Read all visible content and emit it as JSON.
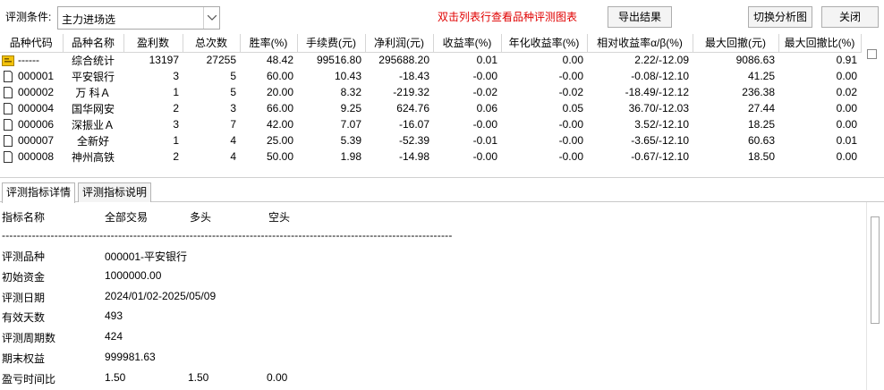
{
  "toolbar": {
    "condition_label": "评测条件:",
    "condition_value": "主力进场选",
    "hint": "双击列表行查看品种评测图表",
    "export_label": "导出结果",
    "switch_label": "切换分析图",
    "close_label": "关闭"
  },
  "table": {
    "columns": [
      "品种代码",
      "品种名称",
      "盈利数",
      "总次数",
      "胜率(%)",
      "手续费(元)",
      "净利润(元)",
      "收益率(%)",
      "年化收益率(%)",
      "相对收益率α/β(%)",
      "最大回撤(元)",
      "最大回撤比(%)"
    ],
    "rows": [
      {
        "code": "------",
        "name": "综合统计",
        "win": "13197",
        "total": "27255",
        "rate": "48.42",
        "fee": "99516.80",
        "profit": "295688.20",
        "ret": "0.01",
        "annual": "0.00",
        "rel": "2.22/-12.09",
        "mdd": "9086.63",
        "mddr": "0.91",
        "icon": "summary-icon"
      },
      {
        "code": "000001",
        "name": "平安银行",
        "win": "3",
        "total": "5",
        "rate": "60.00",
        "fee": "10.43",
        "profit": "-18.43",
        "ret": "-0.00",
        "annual": "-0.00",
        "rel": "-0.08/-12.10",
        "mdd": "41.25",
        "mddr": "0.00",
        "icon": "document-icon"
      },
      {
        "code": "000002",
        "name": "万 科Ａ",
        "win": "1",
        "total": "5",
        "rate": "20.00",
        "fee": "8.32",
        "profit": "-219.32",
        "ret": "-0.02",
        "annual": "-0.02",
        "rel": "-18.49/-12.12",
        "mdd": "236.38",
        "mddr": "0.02",
        "icon": "document-icon"
      },
      {
        "code": "000004",
        "name": "国华网安",
        "win": "2",
        "total": "3",
        "rate": "66.00",
        "fee": "9.25",
        "profit": "624.76",
        "ret": "0.06",
        "annual": "0.05",
        "rel": "36.70/-12.03",
        "mdd": "27.44",
        "mddr": "0.00",
        "icon": "document-icon"
      },
      {
        "code": "000006",
        "name": "深振业Ａ",
        "win": "3",
        "total": "7",
        "rate": "42.00",
        "fee": "7.07",
        "profit": "-16.07",
        "ret": "-0.00",
        "annual": "-0.00",
        "rel": "3.52/-12.10",
        "mdd": "18.25",
        "mddr": "0.00",
        "icon": "document-icon"
      },
      {
        "code": "000007",
        "name": "全新好",
        "win": "1",
        "total": "4",
        "rate": "25.00",
        "fee": "5.39",
        "profit": "-52.39",
        "ret": "-0.01",
        "annual": "-0.00",
        "rel": "-3.65/-12.10",
        "mdd": "60.63",
        "mddr": "0.01",
        "icon": "document-icon"
      },
      {
        "code": "000008",
        "name": "神州高铁",
        "win": "2",
        "total": "4",
        "rate": "50.00",
        "fee": "1.98",
        "profit": "-14.98",
        "ret": "-0.00",
        "annual": "-0.00",
        "rel": "-0.67/-12.10",
        "mdd": "18.50",
        "mddr": "0.00",
        "icon": "document-icon"
      }
    ]
  },
  "tabs": [
    "评测指标详情",
    "评测指标说明"
  ],
  "detail": {
    "header": {
      "name": "指标名称",
      "all": "全部交易",
      "long": "多头",
      "short": "空头"
    },
    "separator": "------------------------------------------------------------------------------------------------------------------------",
    "items": [
      {
        "label": "评测品种",
        "v1": "000001-平安银行",
        "v2": "",
        "v3": ""
      },
      {
        "label": "初始资金",
        "v1": "1000000.00",
        "v2": "",
        "v3": ""
      },
      {
        "label": "评测日期",
        "v1": "2024/01/02-2025/05/09",
        "v2": "",
        "v3": ""
      },
      {
        "label": "有效天数",
        "v1": "493",
        "v2": "",
        "v3": ""
      },
      {
        "label": "评测周期数",
        "v1": " 424",
        "v2": "",
        "v3": ""
      },
      {
        "label": "期末权益",
        "v1": "999981.63",
        "v2": "",
        "v3": ""
      },
      {
        "label": "盈亏时间比",
        "v1": " 1.50",
        "v2": "1.50",
        "v3": "0.00"
      }
    ]
  }
}
